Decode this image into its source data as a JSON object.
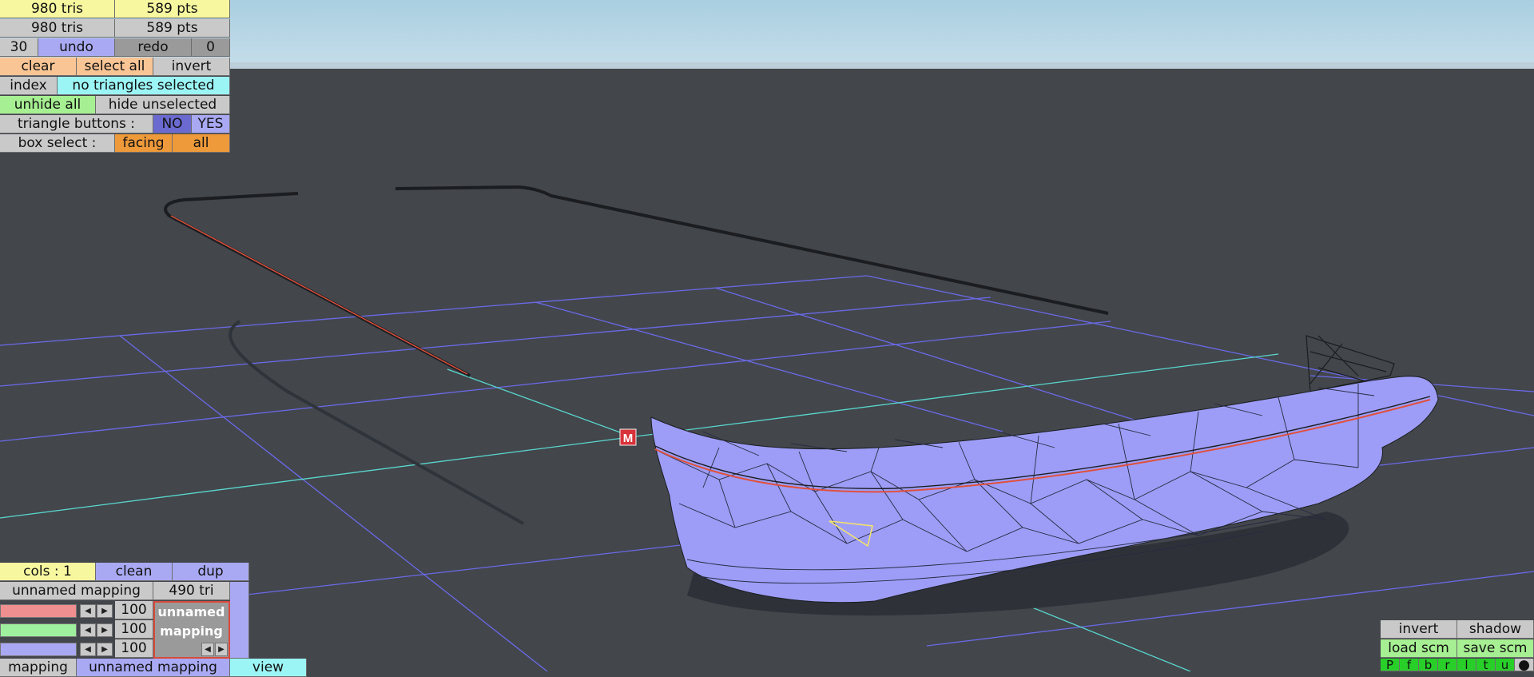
{
  "scene": {
    "marker_label": "M",
    "colors": {
      "background": "#43464b",
      "sky_top": "#a9cfe1",
      "sky_bottom": "#c6ddea",
      "mesh_fill": "#9d9df7",
      "grid": "#6a6ae8",
      "axis": "#59d8cf",
      "selection": "#f3e36a",
      "edge_red": "#e0503c",
      "marker": "#d8323a"
    }
  },
  "top_panel": {
    "tris_total": "980 tris",
    "pts_total": "589 pts",
    "tris_visible": "980 tris",
    "pts_visible": "589 pts",
    "undo_count": "30",
    "undo": "undo",
    "redo": "redo",
    "redo_count": "0",
    "clear": "clear",
    "select_all": "select all",
    "invert": "invert",
    "index": "index",
    "selection_status": "no triangles selected",
    "unhide_all": "unhide all",
    "hide_unselected": "hide unselected",
    "triangle_buttons_label": "triangle buttons :",
    "no": "NO",
    "yes": "YES",
    "box_select_label": "box select :",
    "facing": "facing",
    "all": "all"
  },
  "mapping_panel": {
    "cols": "cols : 1",
    "clean": "clean",
    "dup": "dup",
    "mapping_name": "unnamed mapping",
    "mapping_tris": "490 tri",
    "red": "100",
    "green": "100",
    "blue": "100",
    "swatch_label": "unnamed mapping",
    "color_levels": {
      "red": 1.0,
      "green": 1.0,
      "blue": 1.0
    }
  },
  "bottom_tabs": {
    "mapping": "mapping",
    "current": "unnamed mapping",
    "view": "view"
  },
  "right_panel": {
    "invert": "invert",
    "shadow": "shadow",
    "load_scm": "load scm",
    "save_scm": "save scm",
    "mode_buttons": [
      "P",
      "f",
      "b",
      "r",
      "l",
      "t",
      "u",
      "●"
    ]
  }
}
